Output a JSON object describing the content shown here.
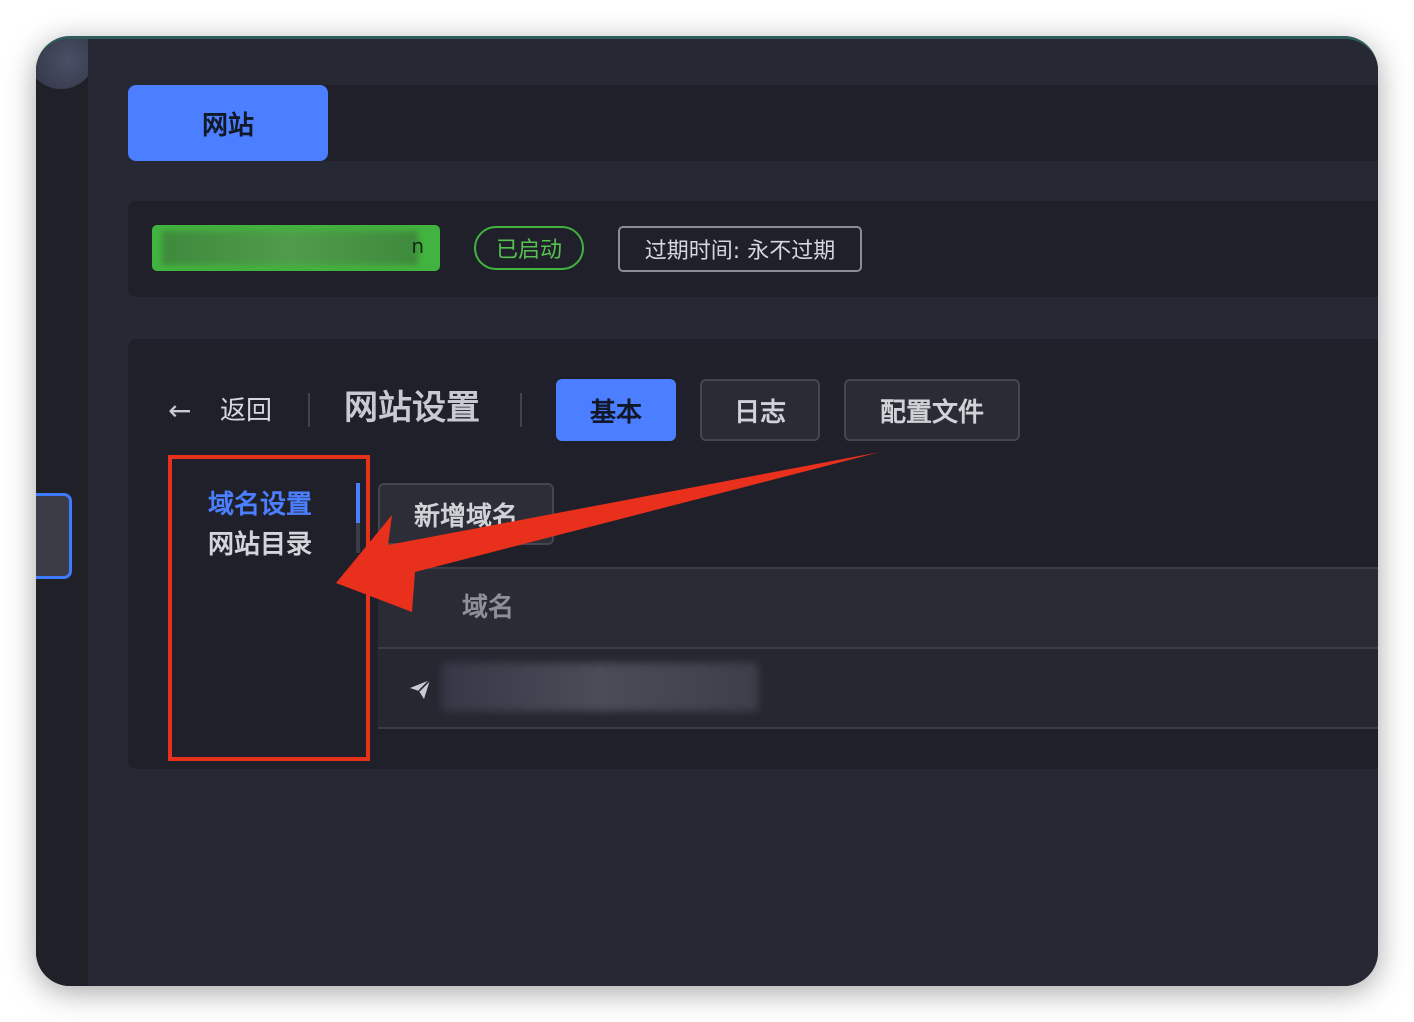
{
  "tabs": {
    "site_tab": "网站"
  },
  "info": {
    "site_name": "n",
    "status": "已启动",
    "expiry": "过期时间: 永不过期"
  },
  "settings": {
    "back_icon": "←",
    "back_label": "返回",
    "title": "网站设置",
    "segments": [
      {
        "label": "基本",
        "active": true
      },
      {
        "label": "日志",
        "active": false
      },
      {
        "label": "配置文件",
        "active": false
      }
    ],
    "side_menu": [
      {
        "label": "域名设置",
        "active": true
      },
      {
        "label": "网站目录",
        "active": false
      }
    ],
    "add_domain_label": "新增域名",
    "table": {
      "column_domain": "域名"
    }
  },
  "colors": {
    "accent": "#4c7fff",
    "success": "#43b33f",
    "annotation": "#e8301c",
    "background": "#262833"
  },
  "icons": {
    "back": "arrow-left-icon",
    "row": "paper-plane-icon"
  }
}
